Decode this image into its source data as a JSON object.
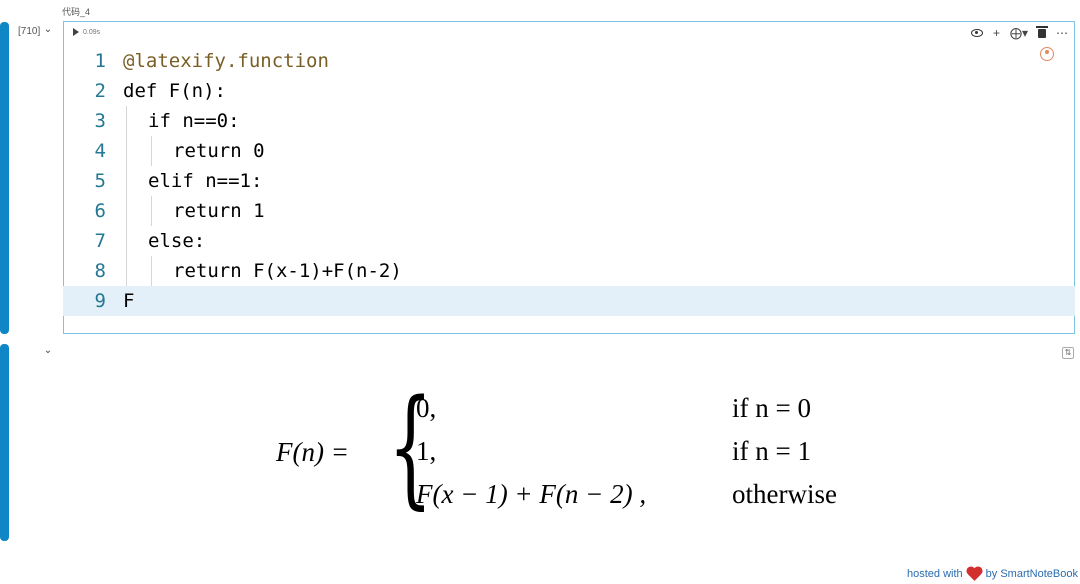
{
  "cell": {
    "label": "代码_4",
    "exec_count": "[710]",
    "run_time": "0.09s"
  },
  "code": {
    "lines": [
      {
        "num": "1",
        "text": "@latexify.function"
      },
      {
        "num": "2",
        "text": "def F(n):"
      },
      {
        "num": "3",
        "text": "if n==0:"
      },
      {
        "num": "4",
        "text": "return 0"
      },
      {
        "num": "5",
        "text": "elif n==1:"
      },
      {
        "num": "6",
        "text": "return 1"
      },
      {
        "num": "7",
        "text": "else:"
      },
      {
        "num": "8",
        "text": "return F(x-1)+F(n-2)"
      },
      {
        "num": "9",
        "text": "F"
      }
    ]
  },
  "toolbar": {
    "icons": [
      "eye-icon",
      "plus-icon",
      "copy-icon",
      "chevron-down-icon",
      "trash-icon",
      "more-icon"
    ]
  },
  "output": {
    "lhs": "F(n) =",
    "cases": [
      {
        "value": "0,",
        "condition": "if n = 0"
      },
      {
        "value": "1,",
        "condition": "if n = 1"
      },
      {
        "value": "F(x − 1) + F(n − 2) ,",
        "condition": "otherwise"
      }
    ]
  },
  "footer": {
    "prefix": "hosted with",
    "suffix": "by SmartNoteBook"
  },
  "colors": {
    "accent": "#0f86c6",
    "keyword": "#0000ff",
    "number": "#098658",
    "line_number": "#237893"
  }
}
